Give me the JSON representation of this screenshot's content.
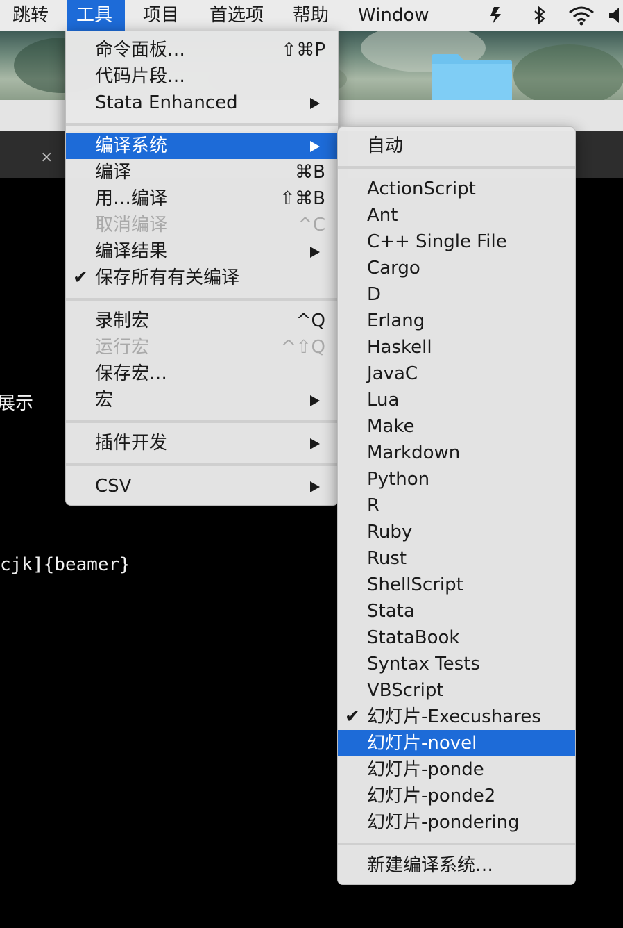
{
  "menubar": {
    "items": [
      "跳转",
      "工具",
      "项目",
      "首选项",
      "帮助",
      "Window"
    ],
    "active_index": 1
  },
  "editor": {
    "tab_close": "×",
    "lines": [
      "展示",
      "cjk]{beamer}"
    ]
  },
  "tools_menu": {
    "groups": [
      [
        {
          "label": "命令面板…",
          "shortcut": "⇧⌘P"
        },
        {
          "label": "代码片段…",
          "shortcut": ""
        },
        {
          "label": "Stata Enhanced",
          "submenu": true
        }
      ],
      [
        {
          "label": "编译系统",
          "submenu": true,
          "highlighted": true
        },
        {
          "label": "编译",
          "shortcut": "⌘B"
        },
        {
          "label": "用…编译",
          "shortcut": "⇧⌘B"
        },
        {
          "label": "取消编译",
          "shortcut": "^C",
          "disabled": true
        },
        {
          "label": "编译结果",
          "submenu": true
        },
        {
          "label": "保存所有有关编译",
          "checked": true
        }
      ],
      [
        {
          "label": "录制宏",
          "shortcut": "^Q"
        },
        {
          "label": "运行宏",
          "shortcut": "^⇧Q",
          "disabled": true
        },
        {
          "label": "保存宏…",
          "shortcut": ""
        },
        {
          "label": "宏",
          "submenu": true
        }
      ],
      [
        {
          "label": "插件开发",
          "submenu": true
        }
      ],
      [
        {
          "label": "CSV",
          "submenu": true
        }
      ]
    ]
  },
  "build_menu": {
    "auto": "自动",
    "systems": [
      "ActionScript",
      "Ant",
      "C++ Single File",
      "Cargo",
      "D",
      "Erlang",
      "Haskell",
      "JavaC",
      "Lua",
      "Make",
      "Markdown",
      "Python",
      "R",
      "Ruby",
      "Rust",
      "ShellScript",
      "Stata",
      "StataBook",
      "Syntax Tests",
      "VBScript",
      "幻灯片-Execushares",
      "幻灯片-novel",
      "幻灯片-ponde",
      "幻灯片-ponde2",
      "幻灯片-pondering"
    ],
    "checked_item": "幻灯片-Execushares",
    "highlighted_item": "幻灯片-novel",
    "new_build_system": "新建编译系统…"
  }
}
